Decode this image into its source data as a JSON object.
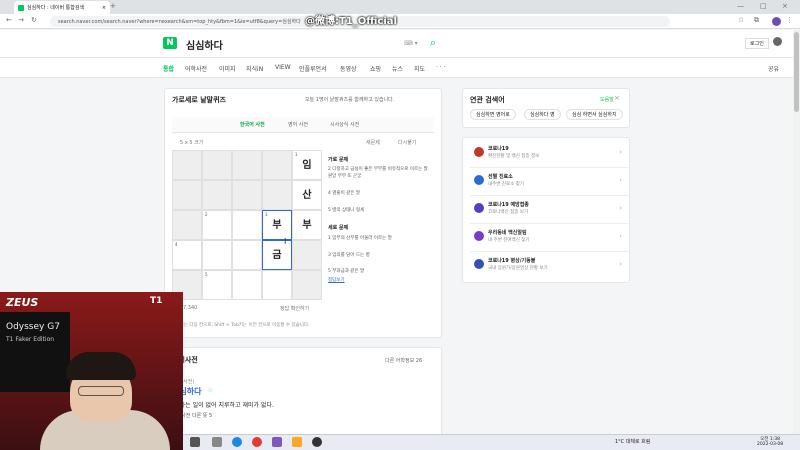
{
  "browser": {
    "tab_title": "심심하다 : 네이버 통합검색",
    "new_tab": "+",
    "url": "search.naver.com/search.naver?where=nexearch&sm=top_hty&fbm=1&ie=utf8&query=심심하다",
    "overlay": "@微博:T1_Official"
  },
  "header": {
    "logo": "N",
    "query": "심심하다",
    "login": "로그인"
  },
  "nav": {
    "items": [
      "통합",
      "어학사전",
      "이미지",
      "지식iN",
      "VIEW",
      "인플루언서",
      "동영상",
      "쇼핑",
      "뉴스",
      "지도",
      "· · ·"
    ],
    "share": "공유"
  },
  "quiz": {
    "title": "가로세로 낱말퀴즈",
    "subtitle": "오늘 1명이 낱말퀴즈를 함께하고 있습니다.",
    "tabs": [
      "한국어 사전",
      "영어 사전",
      "시사상식 사전"
    ],
    "size": "5 x 5 크기",
    "new_btn": "새문제",
    "retry_btn": "다시풀기",
    "cells": [
      {
        "n": "1",
        "ch": "임"
      },
      {
        "n": "",
        "ch": "산"
      },
      {
        "n": "",
        "ch": "부"
      },
      {
        "n": "2",
        "ch": ""
      },
      {
        "n": "3",
        "ch": "부"
      },
      {
        "n": "4",
        "ch": ""
      },
      {
        "n": "",
        "ch": "금"
      },
      {
        "n": "5",
        "ch": ""
      }
    ],
    "across_title": "가로 문제",
    "across": [
      "2 다정하고 금실이 좋은 부부를 비유적으로 이르는 말. 원앙 부부 또 곤궁",
      "4 옆줄이 같은 말",
      "5 병의 상태나 형세"
    ],
    "down_title": "세로 문제",
    "down": [
      "1 임부의 산부를 아울러 이르는 말",
      "3 임의를 담아 드는 병",
      "5 부과금과 같은 말"
    ],
    "hint_link": "정답보기",
    "count": "7,340",
    "answer_btn": "정답 확인하기",
    "footer": "Tab키는 다음 칸으로, Shift + Tab키는 이전 칸으로 이동할 수 있습니다."
  },
  "dict": {
    "title": "국어사전",
    "other": "다른 어학정보 26",
    "origin": "(국어사전)",
    "word": "심심하다",
    "pron": "☞",
    "def": "1. 하는 일이 없어 지루하고 재미가 없다.",
    "more": "국어사전 다른 뜻 5"
  },
  "related": {
    "title": "연관 검색어",
    "badge": "도움말",
    "items": [
      "심심하면 영어로",
      "심심하다 영",
      "심심 하면서 심심하지"
    ]
  },
  "covid": {
    "items": [
      {
        "t": "코로나19",
        "s": "확진현황 및 백신 접종 정보",
        "c": "#c0392b"
      },
      {
        "t": "선별 진료소",
        "s": "내주변 진료소 찾기",
        "c": "#2e6bd1"
      },
      {
        "t": "코로나19 예방접종",
        "s": "코로나백신 접종 보기",
        "c": "#5a3cc4"
      },
      {
        "t": "우리동네 백신알림",
        "s": "내 주변 잔여백신 찾기",
        "c": "#7b3cc4"
      },
      {
        "t": "코로나19 병상/기동불",
        "s": "국내 응원가/응원영상 현황 보기",
        "c": "#3450b5"
      }
    ]
  },
  "stream": {
    "team": "ZEUS",
    "t1": "T1",
    "monitor_brand": "Odyssey G7",
    "monitor_sub": "T1 Faker Edition"
  },
  "taskbar": {
    "weather": "1°C 대체로 흐림",
    "time": "오전 1:38",
    "date": "2022-03-08"
  }
}
